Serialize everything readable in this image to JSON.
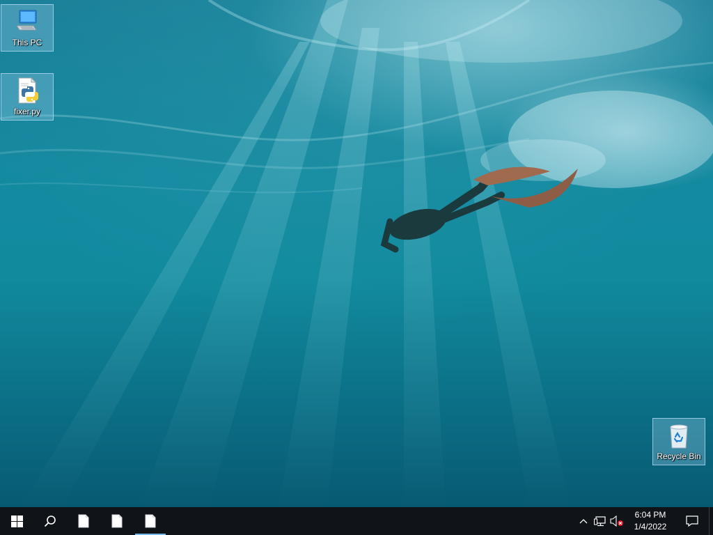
{
  "desktop": {
    "icons": [
      {
        "label": "This PC",
        "icon": "computer-icon"
      },
      {
        "label": "fixer.py",
        "icon": "python-file-icon"
      },
      {
        "label": "Recycle Bin",
        "icon": "recycle-bin-icon"
      }
    ]
  },
  "taskbar": {
    "start_icon": "windows-logo-icon",
    "search_icon": "search-icon",
    "apps": [
      {
        "icon": "document-icon",
        "active": false
      },
      {
        "icon": "document-icon",
        "active": false
      },
      {
        "icon": "document-icon",
        "active": true
      }
    ],
    "tray": {
      "chevron_icon": "chevron-up-icon",
      "network_icon": "network-icon",
      "volume_icon": "volume-muted-icon",
      "time": "6:04 PM",
      "date": "1/4/2022",
      "notification_icon": "action-center-icon"
    }
  },
  "colors": {
    "taskbar_bg": "#101418",
    "active_indicator": "#76b9ed",
    "icon_selection": "#96c8e6"
  }
}
